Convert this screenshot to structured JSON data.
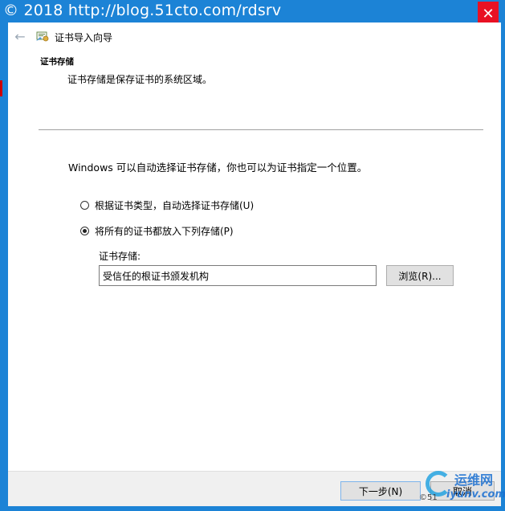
{
  "watermark": "© 2018 http://blog.51cto.com/rdsrv",
  "window": {
    "close_glyph": "✕",
    "back_glyph": "←",
    "title": "证书导入向导"
  },
  "header": {
    "title": "证书存储",
    "description": "证书存储是保存证书的系统区域。"
  },
  "body": {
    "intro": "Windows 可以自动选择证书存储，你也可以为证书指定一个位置。",
    "options": [
      {
        "label": "根据证书类型，自动选择证书存储(U)",
        "selected": false
      },
      {
        "label": "将所有的证书都放入下列存储(P)",
        "selected": true
      }
    ],
    "store_label": "证书存储:",
    "store_value": "受信任的根证书颁发机构",
    "browse_label": "浏览(R)..."
  },
  "footer": {
    "next_label": "下一步(N)",
    "cancel_label": "取消"
  },
  "logo_watermark": {
    "line1": "运维网",
    "line2": "iyunv.com",
    "small": "©51"
  },
  "colors": {
    "title_bar": "#1c83d6",
    "close_button": "#e81123",
    "footer": "#f0f0f0",
    "button_face": "#e1e1e1",
    "default_button_border": "#7eb4ea"
  },
  "icons": {
    "back": "back-arrow-icon",
    "wizard": "certificate-wizard-icon",
    "close": "close-icon"
  }
}
